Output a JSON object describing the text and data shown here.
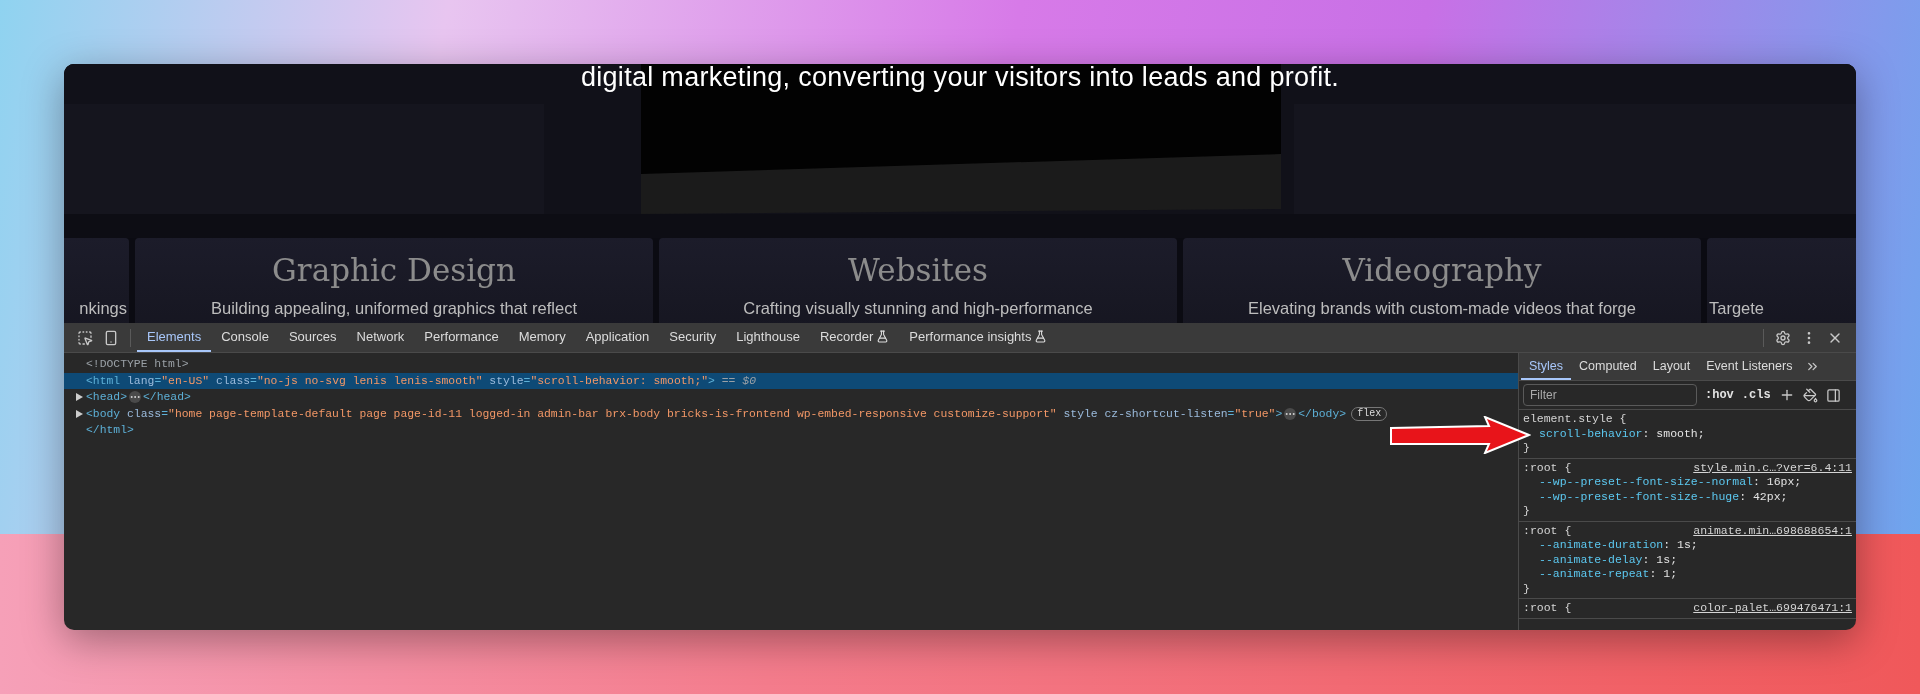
{
  "website": {
    "headline": "digital marketing, converting your visitors into leads and profit.",
    "cards": [
      {
        "description": "nkings",
        "kind": "left"
      },
      {
        "title": "Graphic Design",
        "description": "Building appealing, uniformed graphics that reflect",
        "kind": "full"
      },
      {
        "title": "Websites",
        "description": "Crafting visually stunning and high-performance",
        "kind": "full"
      },
      {
        "title": "Videography",
        "description": "Elevating brands with custom-made videos that forge",
        "kind": "full"
      },
      {
        "description": "Targete",
        "kind": "right"
      }
    ]
  },
  "devtools": {
    "tabs": [
      {
        "label": "Elements",
        "selected": true,
        "experimental": false
      },
      {
        "label": "Console",
        "selected": false,
        "experimental": false
      },
      {
        "label": "Sources",
        "selected": false,
        "experimental": false
      },
      {
        "label": "Network",
        "selected": false,
        "experimental": false
      },
      {
        "label": "Performance",
        "selected": false,
        "experimental": false
      },
      {
        "label": "Memory",
        "selected": false,
        "experimental": false
      },
      {
        "label": "Application",
        "selected": false,
        "experimental": false
      },
      {
        "label": "Security",
        "selected": false,
        "experimental": false
      },
      {
        "label": "Lighthouse",
        "selected": false,
        "experimental": false
      },
      {
        "label": "Recorder",
        "selected": false,
        "experimental": true
      },
      {
        "label": "Performance insights",
        "selected": false,
        "experimental": true
      }
    ],
    "dom": [
      {
        "selected": false,
        "segments": [
          {
            "kind": "doctype",
            "text": "<!DOCTYPE html>"
          }
        ]
      },
      {
        "selected": true,
        "segments": [
          {
            "kind": "tag",
            "text": "<html"
          },
          {
            "kind": "attr",
            "text": " lang"
          },
          {
            "kind": "tag",
            "text": "="
          },
          {
            "kind": "value",
            "text": "\"en-US\""
          },
          {
            "kind": "attr",
            "text": " class"
          },
          {
            "kind": "tag",
            "text": "="
          },
          {
            "kind": "value",
            "text": "\"no-js no-svg lenis lenis-smooth\""
          },
          {
            "kind": "attr",
            "text": " style"
          },
          {
            "kind": "tag",
            "text": "="
          },
          {
            "kind": "value",
            "text": "\"scroll-behavior: smooth;\""
          },
          {
            "kind": "tag",
            "text": ">"
          },
          {
            "kind": "ref",
            "text": " == $0"
          }
        ]
      },
      {
        "selected": false,
        "expanded": false,
        "segments": [
          {
            "kind": "tag",
            "text": "<head>"
          },
          {
            "kind": "ellipsis"
          },
          {
            "kind": "tag",
            "text": "</head>"
          }
        ]
      },
      {
        "selected": false,
        "expanded": false,
        "segments": [
          {
            "kind": "tag",
            "text": "<body"
          },
          {
            "kind": "attr",
            "text": " class"
          },
          {
            "kind": "tag",
            "text": "="
          },
          {
            "kind": "value",
            "text": "\"home page-template-default page page-id-11 logged-in admin-bar brx-body bricks-is-frontend wp-embed-responsive customize-support\""
          },
          {
            "kind": "attr",
            "text": " style cz-shortcut-listen"
          },
          {
            "kind": "tag",
            "text": "="
          },
          {
            "kind": "value",
            "text": "\"true\""
          },
          {
            "kind": "tag",
            "text": ">"
          },
          {
            "kind": "ellipsis"
          },
          {
            "kind": "tag",
            "text": "</body>"
          },
          {
            "kind": "badge",
            "text": "flex"
          }
        ]
      },
      {
        "selected": false,
        "segments": [
          {
            "kind": "tag",
            "text": "</html>"
          }
        ]
      }
    ],
    "sidebar": {
      "tabs": [
        {
          "label": "Styles",
          "selected": true
        },
        {
          "label": "Computed",
          "selected": false
        },
        {
          "label": "Layout",
          "selected": false
        },
        {
          "label": "Event Listeners",
          "selected": false
        }
      ],
      "filter": {
        "placeholder": "Filter"
      },
      "hov": ":hov",
      "cls": ".cls",
      "rules": [
        {
          "selector": "element.style {",
          "close": "}",
          "declarations": [
            {
              "property": "scroll-behavior",
              "value": ": smooth;"
            }
          ]
        },
        {
          "selector": ":root {",
          "source": "style.min.c…?ver=6.4:11",
          "close": "}",
          "declarations": [
            {
              "property": "--wp--preset--font-size--normal",
              "value": ": 16px;"
            },
            {
              "property": "--wp--preset--font-size--huge",
              "value": ": 42px;"
            }
          ]
        },
        {
          "selector": ":root {",
          "source": "animate.min…698688654:1",
          "close": "}",
          "declarations": [
            {
              "property": "--animate-duration",
              "value": ": 1s;"
            },
            {
              "property": "--animate-delay",
              "value": ": 1s;"
            },
            {
              "property": "--animate-repeat",
              "value": ": 1;"
            }
          ]
        },
        {
          "selector": ":root {",
          "source": "color-palet…699476471:1"
        }
      ]
    }
  }
}
